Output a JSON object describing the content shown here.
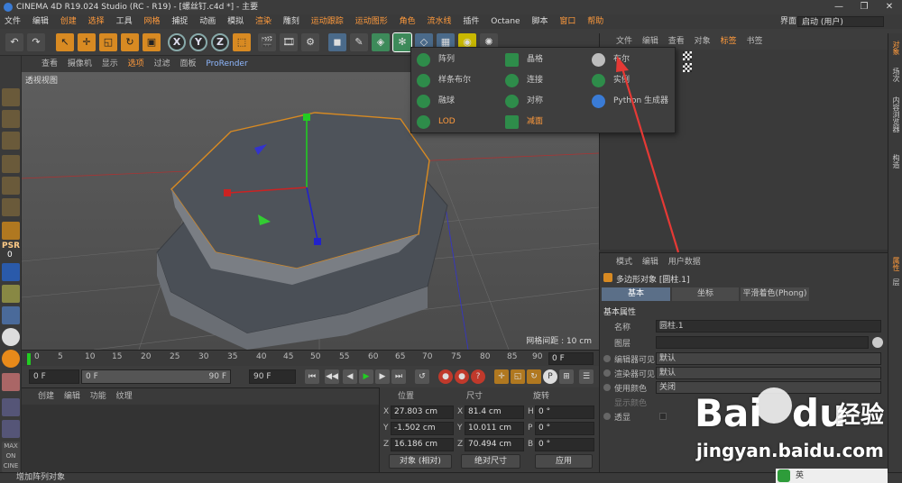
{
  "window": {
    "title": "CINEMA 4D R19.024 Studio (RC - R19) - [螺丝钉.c4d *] - 主要",
    "minimize": "—",
    "maximize": "❐",
    "close": "✕"
  },
  "menu": {
    "items": [
      "文件",
      "编辑",
      "创建",
      "选择",
      "工具",
      "网格",
      "捕捉",
      "动画",
      "模拟",
      "渲染",
      "雕刻",
      "运动跟踪",
      "运动图形",
      "角色",
      "流水线",
      "插件",
      "Octane",
      "脚本",
      "窗口",
      "帮助"
    ],
    "layout_label": "界面:",
    "layout_value": "启动 (用户)"
  },
  "viewport": {
    "menu": [
      "查看",
      "摄像机",
      "显示",
      "选项",
      "过滤",
      "面板"
    ],
    "prorender": "ProRender",
    "label": "透视视图",
    "grid_spacing": "网格间距 : 10 cm"
  },
  "generator_menu": {
    "items": [
      {
        "label": "阵列"
      },
      {
        "label": "晶格"
      },
      {
        "label": "布尔"
      },
      {
        "label": "样条布尔"
      },
      {
        "label": "连接"
      },
      {
        "label": "实例"
      },
      {
        "label": "融球"
      },
      {
        "label": "对称"
      },
      {
        "label": "Python 生成器"
      },
      {
        "label": "LOD"
      },
      {
        "label": "减面"
      }
    ]
  },
  "timeline": {
    "ticks": [
      "0",
      "5",
      "10",
      "15",
      "20",
      "25",
      "30",
      "35",
      "40",
      "45",
      "50",
      "55",
      "60",
      "65",
      "70",
      "75",
      "80",
      "85",
      "90"
    ],
    "current_frame": "0 F"
  },
  "playback": {
    "start": "0 F",
    "min": "0 F",
    "max": "90 F",
    "end": "90 F"
  },
  "material": {
    "menu": [
      "创建",
      "编辑",
      "功能",
      "纹理"
    ]
  },
  "coords": {
    "headers": [
      "位置",
      "尺寸",
      "旋转"
    ],
    "rows": [
      {
        "axis": "X",
        "pos": "27.803 cm",
        "size_axis": "X",
        "size": "81.4 cm",
        "rot_axis": "H",
        "rot": "0 °"
      },
      {
        "axis": "Y",
        "pos": "-1.502 cm",
        "size_axis": "Y",
        "size": "10.011 cm",
        "rot_axis": "P",
        "rot": "0 °"
      },
      {
        "axis": "Z",
        "pos": "16.186 cm",
        "size_axis": "Z",
        "size": "70.494 cm",
        "rot_axis": "B",
        "rot": "0 °"
      }
    ],
    "mode": "对象 (相对)",
    "size_mode": "绝对尺寸",
    "apply": "应用"
  },
  "objects": {
    "menu": [
      "文件",
      "编辑",
      "查看",
      "对象",
      "标签",
      "书签"
    ]
  },
  "attributes": {
    "menu": [
      "模式",
      "编辑",
      "用户数据"
    ],
    "object_title": "多边形对象 [圆柱.1]",
    "tabs": [
      "基本",
      "坐标",
      "平滑着色(Phong)"
    ],
    "section": "基本属性",
    "fields": [
      {
        "label": "名称",
        "value": "圆柱.1"
      },
      {
        "label": "图层",
        "value": ""
      },
      {
        "label": "编辑器可见",
        "value": "默认"
      },
      {
        "label": "渲染器可见",
        "value": "默认"
      },
      {
        "label": "使用颜色",
        "value": "关闭"
      },
      {
        "label": "显示颜色",
        "value": ""
      },
      {
        "label": "透显",
        "value": ""
      }
    ]
  },
  "right_sidebar": [
    "对象",
    "场次",
    "内容浏览器",
    "构造",
    "属性",
    "层"
  ],
  "left_tools": {
    "psr_label": "PSR",
    "psr_value": "0"
  },
  "status": "增加阵列对象",
  "watermark": {
    "brand": "Bai",
    "paw": "du",
    "text": "经验",
    "url": "jingyan.baidu.com"
  },
  "tray": {
    "ime": "英"
  },
  "colors": {
    "accent": "#ff9a3c",
    "selection": "#5b6f88",
    "generator_green": "#2e8c4a",
    "arrow_red": "#e53935"
  }
}
